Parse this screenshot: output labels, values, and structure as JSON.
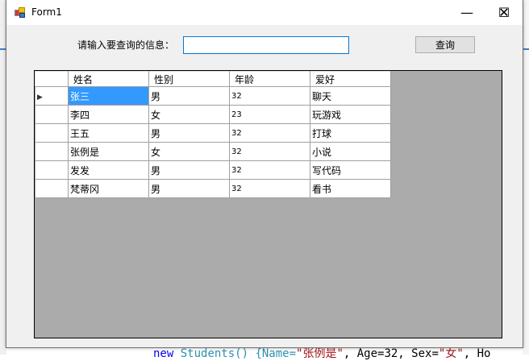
{
  "window": {
    "title": "Form1",
    "minimize": "—",
    "maximize": "☐",
    "close": "✕"
  },
  "search": {
    "label": "请输入要查询的信息：",
    "value": "",
    "button": "查询"
  },
  "grid": {
    "columns": [
      "姓名",
      "性别",
      "年龄",
      "爱好"
    ],
    "rows": [
      [
        "张三",
        "男",
        "32",
        "聊天"
      ],
      [
        "李四",
        "女",
        "23",
        "玩游戏"
      ],
      [
        "王五",
        "男",
        "32",
        "打球"
      ],
      [
        "张例是",
        "女",
        "32",
        "小说"
      ],
      [
        "发发",
        "男",
        "32",
        "写代码"
      ],
      [
        "梵蒂冈",
        "男",
        "32",
        "看书"
      ]
    ],
    "current_row_marker": "▶"
  },
  "background_code": {
    "a": "new",
    "b": " Students() {Name=",
    "c": "\"张例是\"",
    "d": ", Age=32, Sex=",
    "e": "\"女\"",
    "f": ", Ho"
  }
}
